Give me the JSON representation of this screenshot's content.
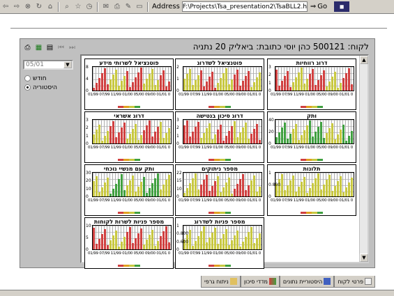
{
  "browser": {
    "address_label": "Address",
    "address_value": "F:\\Projects\\Tsa_presentation2\\TsaBLL2.html",
    "go_label": "Go"
  },
  "header": {
    "title": "לקוח: 500121 כהן יוסי כתובת: ביאליק 20 נתניה"
  },
  "filter": {
    "date_value": "05/01",
    "radio_new": "חודש",
    "radio_history": "היסטוריה"
  },
  "cards": [
    {
      "title": "פוטנציאל לשרותי מידע",
      "yticks": [
        "8",
        "4",
        "0"
      ],
      "xticks": "01/99 07/99 11/99 01/00 05/00 09/00 01/01 05/01",
      "colors": [
        "#d04040",
        "#c8c840"
      ]
    },
    {
      "title": "פוטנציאל לשדרוג",
      "yticks": [
        "2",
        "1",
        "0"
      ],
      "xticks": "01/99 07/99 11/99 01/00 05/00 09/00 01/01 05/01",
      "colors": [
        "#d04040",
        "#c8c840"
      ]
    },
    {
      "title": "דרוג רווחיות",
      "yticks": [
        "3",
        "2",
        "1",
        "0"
      ],
      "xticks": "01/99 07/99 11/99 01/00 05/00 09/00 01/01 05/01",
      "colors": [
        "#d04040",
        "#c8c840"
      ]
    },
    {
      "title": "דרוג אשראי",
      "yticks": [
        "3",
        "2",
        "1",
        "0"
      ],
      "xticks": "01/99 07/99 11/99 01/00 05/00 09/00 01/01 05/01",
      "colors": [
        "#d04040",
        "#c8c840"
      ]
    },
    {
      "title": "דרוג סיכון בנטישה",
      "yticks": [
        "3",
        "2",
        "1",
        "0"
      ],
      "xticks": "01/99 07/99 11/99 01/00 05/00 09/00 01/01 05/01",
      "colors": [
        "#d04040",
        "#c8c840"
      ]
    },
    {
      "title": "ותק",
      "yticks": [
        "40",
        "20",
        "0"
      ],
      "xticks": "01/99 07/99 11/99 01/00 05/00 09/00 01/01 05/01",
      "colors": [
        "#c8c840",
        "#40a040"
      ]
    },
    {
      "title": "ותק עם מנשיי נוכחי",
      "yticks": [
        "30",
        "20",
        "10",
        "0"
      ],
      "xticks": "01/99 07/99 11/99 01/00 05/00 09/00 01/01 05/01",
      "colors": [
        "#c8c840",
        "#40a040"
      ]
    },
    {
      "title": "מספר ניתוקים",
      "yticks": [
        "22",
        "15",
        "10",
        "0"
      ],
      "xticks": "01/99 07/99 11/99 01/00 05/00 09/00 01/01 05/01",
      "colors": [
        "#d04040",
        "#c8c840"
      ]
    },
    {
      "title": "תלונות",
      "yticks": [
        "1",
        "0.800",
        "0"
      ],
      "xticks": "01/99 07/99 11/99 01/00 05/00 09/00 01/01 05/01",
      "colors": [
        "#c8c840"
      ]
    },
    {
      "title": "מספר פניות לשרות לקוחות",
      "yticks": [
        "10",
        "5",
        "0"
      ],
      "xticks": "01/99 07/99 11/99 01/00 05/00 09/00 01/01 05/01",
      "colors": [
        "#c8c840",
        "#d04040"
      ]
    },
    {
      "title": "מספר פניות לשדרוג",
      "yticks": [
        "1",
        "0.800",
        "0.600",
        "0"
      ],
      "xticks": "01/99 07/99 11/99 01/00 05/00 09/00 01/01 05/01",
      "colors": [
        "#c8c840"
      ]
    }
  ],
  "tabs": [
    {
      "label": "פרטי לקוח"
    },
    {
      "label": "היסטוריית נתונים"
    },
    {
      "label": "מדדי סיכון"
    },
    {
      "label": "ניתוח גרפי"
    }
  ]
}
